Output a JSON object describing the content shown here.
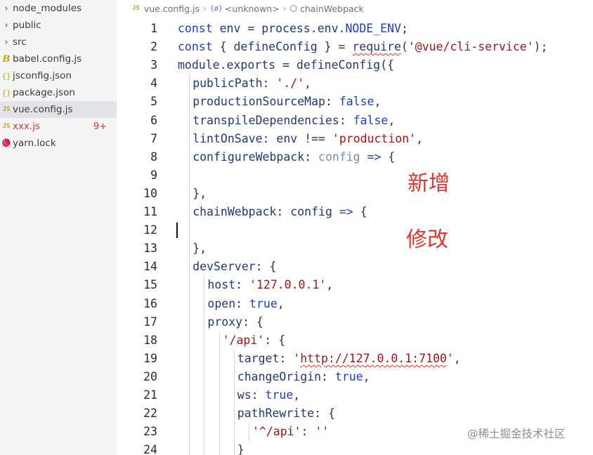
{
  "explorer": {
    "items": [
      {
        "label": "node_modules",
        "icon": "chevron-right-icon",
        "glyph": "›"
      },
      {
        "label": "public",
        "icon": "chevron-right-icon",
        "glyph": "›"
      },
      {
        "label": "src",
        "icon": "chevron-right-icon",
        "glyph": "›"
      },
      {
        "label": "babel.config.js",
        "icon": "babel-icon",
        "glyph": "B"
      },
      {
        "label": "jsconfig.json",
        "icon": "json-icon",
        "glyph": "{}"
      },
      {
        "label": "package.json",
        "icon": "json-icon",
        "glyph": "{}"
      },
      {
        "label": "vue.config.js",
        "icon": "js-file-icon",
        "glyph": "JS",
        "selected": true
      },
      {
        "label": "xxx.js",
        "icon": "js-file-icon",
        "glyph": "JS",
        "badge": "9+",
        "error": true
      },
      {
        "label": "yarn.lock",
        "icon": "yarn-icon",
        "glyph": "🧶"
      }
    ]
  },
  "breadcrumb": {
    "file_icon": "JS",
    "file": "vue.config.js",
    "namespace_icon": "{ø}",
    "scope": "<unknown>",
    "symbol": "chainWebpack"
  },
  "editor": {
    "lines": [
      {
        "n": "1",
        "indent": 0,
        "tokens": [
          [
            "kw",
            "const "
          ],
          [
            "var",
            "env"
          ],
          [
            "plain",
            " = "
          ],
          [
            "var",
            "process"
          ],
          [
            "plain",
            "."
          ],
          [
            "var",
            "env"
          ],
          [
            "plain",
            "."
          ],
          [
            "const",
            "NODE_ENV"
          ],
          [
            "plain",
            ";"
          ]
        ]
      },
      {
        "n": "2",
        "indent": 0,
        "tokens": [
          [
            "kw",
            "const "
          ],
          [
            "plain",
            "{ "
          ],
          [
            "var",
            "defineConfig"
          ],
          [
            "plain",
            " } = "
          ],
          [
            "squig",
            "require"
          ],
          [
            "plain",
            "("
          ],
          [
            "str",
            "'@vue/cli-service'"
          ],
          [
            "plain",
            ");"
          ]
        ]
      },
      {
        "n": "3",
        "indent": 0,
        "tokens": [
          [
            "var",
            "module"
          ],
          [
            "plain",
            "."
          ],
          [
            "var",
            "exports"
          ],
          [
            "plain",
            " = "
          ],
          [
            "var",
            "defineConfig"
          ],
          [
            "plain",
            "({"
          ]
        ]
      },
      {
        "n": "4",
        "indent": 1,
        "tokens": [
          [
            "var",
            "publicPath"
          ],
          [
            "plain",
            ": "
          ],
          [
            "str",
            "'./'"
          ],
          [
            "plain",
            ","
          ]
        ]
      },
      {
        "n": "5",
        "indent": 1,
        "tokens": [
          [
            "var",
            "productionSourceMap"
          ],
          [
            "plain",
            ": "
          ],
          [
            "bool",
            "false"
          ],
          [
            "plain",
            ","
          ]
        ]
      },
      {
        "n": "6",
        "indent": 1,
        "tokens": [
          [
            "var",
            "transpileDependencies"
          ],
          [
            "plain",
            ": "
          ],
          [
            "bool",
            "false"
          ],
          [
            "plain",
            ","
          ]
        ]
      },
      {
        "n": "7",
        "indent": 1,
        "tokens": [
          [
            "var",
            "lintOnSave"
          ],
          [
            "plain",
            ": "
          ],
          [
            "var",
            "env"
          ],
          [
            "plain",
            " !== "
          ],
          [
            "str",
            "'production'"
          ],
          [
            "plain",
            ","
          ]
        ]
      },
      {
        "n": "8",
        "indent": 1,
        "tokens": [
          [
            "var",
            "configureWebpack"
          ],
          [
            "plain",
            ": "
          ],
          [
            "param",
            "config"
          ],
          [
            "arrow",
            " => "
          ],
          [
            "plain",
            "{"
          ]
        ]
      },
      {
        "n": "9",
        "indent": 1,
        "tokens": []
      },
      {
        "n": "10",
        "indent": 1,
        "tokens": [
          [
            "plain",
            "},"
          ]
        ]
      },
      {
        "n": "11",
        "indent": 1,
        "tokens": [
          [
            "var",
            "chainWebpack"
          ],
          [
            "plain",
            ": "
          ],
          [
            "var",
            "config"
          ],
          [
            "arrow",
            " => "
          ],
          [
            "plain",
            "{"
          ]
        ]
      },
      {
        "n": "12",
        "indent": 1,
        "tokens": []
      },
      {
        "n": "13",
        "indent": 1,
        "tokens": [
          [
            "plain",
            "},"
          ]
        ]
      },
      {
        "n": "14",
        "indent": 1,
        "tokens": [
          [
            "var",
            "devServer"
          ],
          [
            "plain",
            ": {"
          ]
        ]
      },
      {
        "n": "15",
        "indent": 2,
        "tokens": [
          [
            "var",
            "host"
          ],
          [
            "plain",
            ": "
          ],
          [
            "str",
            "'127.0.0.1'"
          ],
          [
            "plain",
            ","
          ]
        ]
      },
      {
        "n": "16",
        "indent": 2,
        "tokens": [
          [
            "var",
            "open"
          ],
          [
            "plain",
            ": "
          ],
          [
            "bool",
            "true"
          ],
          [
            "plain",
            ","
          ]
        ]
      },
      {
        "n": "17",
        "indent": 2,
        "tokens": [
          [
            "var",
            "proxy"
          ],
          [
            "plain",
            ": {"
          ]
        ]
      },
      {
        "n": "18",
        "indent": 3,
        "tokens": [
          [
            "str",
            "'/api'"
          ],
          [
            "plain",
            ": {"
          ]
        ]
      },
      {
        "n": "19",
        "indent": 4,
        "tokens": [
          [
            "var",
            "target"
          ],
          [
            "plain",
            ": "
          ],
          [
            "str",
            "'"
          ],
          [
            "squigstr",
            "http://127.0.0.1:7100"
          ],
          [
            "str",
            "'"
          ],
          [
            "plain",
            ","
          ]
        ]
      },
      {
        "n": "20",
        "indent": 4,
        "tokens": [
          [
            "var",
            "changeOrigin"
          ],
          [
            "plain",
            ": "
          ],
          [
            "bool",
            "true"
          ],
          [
            "plain",
            ","
          ]
        ]
      },
      {
        "n": "21",
        "indent": 4,
        "tokens": [
          [
            "var",
            "ws"
          ],
          [
            "plain",
            ": "
          ],
          [
            "bool",
            "true"
          ],
          [
            "plain",
            ","
          ]
        ]
      },
      {
        "n": "22",
        "indent": 4,
        "tokens": [
          [
            "var",
            "pathRewrite"
          ],
          [
            "plain",
            ": {"
          ]
        ]
      },
      {
        "n": "23",
        "indent": 5,
        "tokens": [
          [
            "str",
            "'^/api'"
          ],
          [
            "plain",
            ": "
          ],
          [
            "str",
            "''"
          ]
        ]
      },
      {
        "n": "24",
        "indent": 4,
        "tokens": [
          [
            "plain",
            "}"
          ]
        ]
      }
    ]
  },
  "annotations": {
    "added": "新增",
    "modified": "修改"
  },
  "watermark": "@稀土掘金技术社区",
  "colors": {
    "keyword": "#1a3bd6",
    "identifier": "#1f377f",
    "string": "#a31515",
    "annotation": "#e0362b",
    "error": "#d43a2c"
  }
}
